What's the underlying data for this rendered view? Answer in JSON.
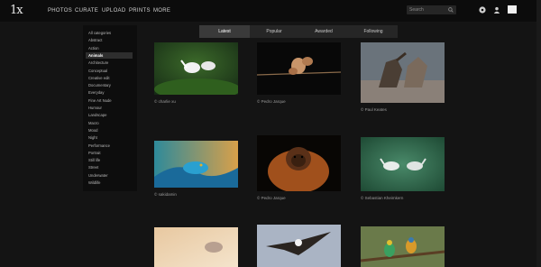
{
  "app": {
    "logo": "1x"
  },
  "nav": {
    "items": [
      "PHOTOS",
      "CURATE",
      "UPLOAD",
      "PRINTS",
      "MORE"
    ]
  },
  "search": {
    "placeholder": "Search"
  },
  "tabs": [
    "Latest",
    "Popular",
    "Awarded",
    "Following"
  ],
  "active_tab": "Latest",
  "categories": [
    "All categories",
    "Abstract",
    "Action",
    "Animals",
    "Architecture",
    "Conceptual",
    "Creative edit",
    "Documentary",
    "Everyday",
    "Fine Art Nude",
    "Humour",
    "Landscape",
    "Macro",
    "Mood",
    "Night",
    "Performance",
    "Portrait",
    "Still life",
    "Street",
    "Underwater",
    "Wildlife"
  ],
  "selected_category": "Animals",
  "photos": [
    {
      "subject": "white egrets on green branches",
      "credit": "© charlie xu"
    },
    {
      "subject": "monkeys fighting on a rope",
      "credit": "© Pedro Jarque"
    },
    {
      "subject": "two horses fighting on beach",
      "credit": "© Paul Keates"
    },
    {
      "subject": "blue viper snake",
      "credit": "© sakidamin"
    },
    {
      "subject": "orangutan portrait",
      "credit": "© Pedro Jarque"
    },
    {
      "subject": "white horses in green mist",
      "credit": "© Sebastian Kheimkern"
    },
    {
      "subject": "animal in warm haze",
      "credit": ""
    },
    {
      "subject": "eagle in flight",
      "credit": ""
    },
    {
      "subject": "bee-eaters on a branch",
      "credit": ""
    }
  ],
  "colors": {
    "background": "#141414",
    "sidebar": "#0d0d0d",
    "tabbar": "#262626"
  }
}
